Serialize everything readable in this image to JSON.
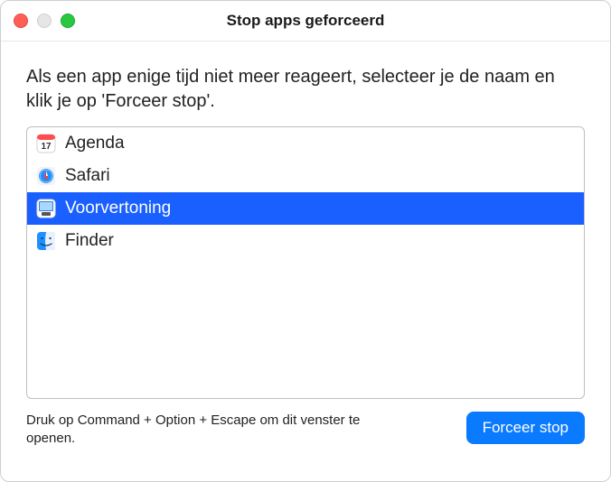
{
  "window": {
    "title": "Stop apps geforceerd"
  },
  "instruction": "Als een app enige tijd niet meer reageert, selecteer je de naam en klik je op 'Forceer stop'.",
  "apps": [
    {
      "name": "Agenda",
      "icon": "calendar-icon",
      "selected": false
    },
    {
      "name": "Safari",
      "icon": "safari-icon",
      "selected": false
    },
    {
      "name": "Voorvertoning",
      "icon": "preview-icon",
      "selected": true
    },
    {
      "name": "Finder",
      "icon": "finder-icon",
      "selected": false
    }
  ],
  "hint": "Druk op Command + Option + Escape om dit venster te openen.",
  "buttons": {
    "force_quit": "Forceer stop"
  }
}
